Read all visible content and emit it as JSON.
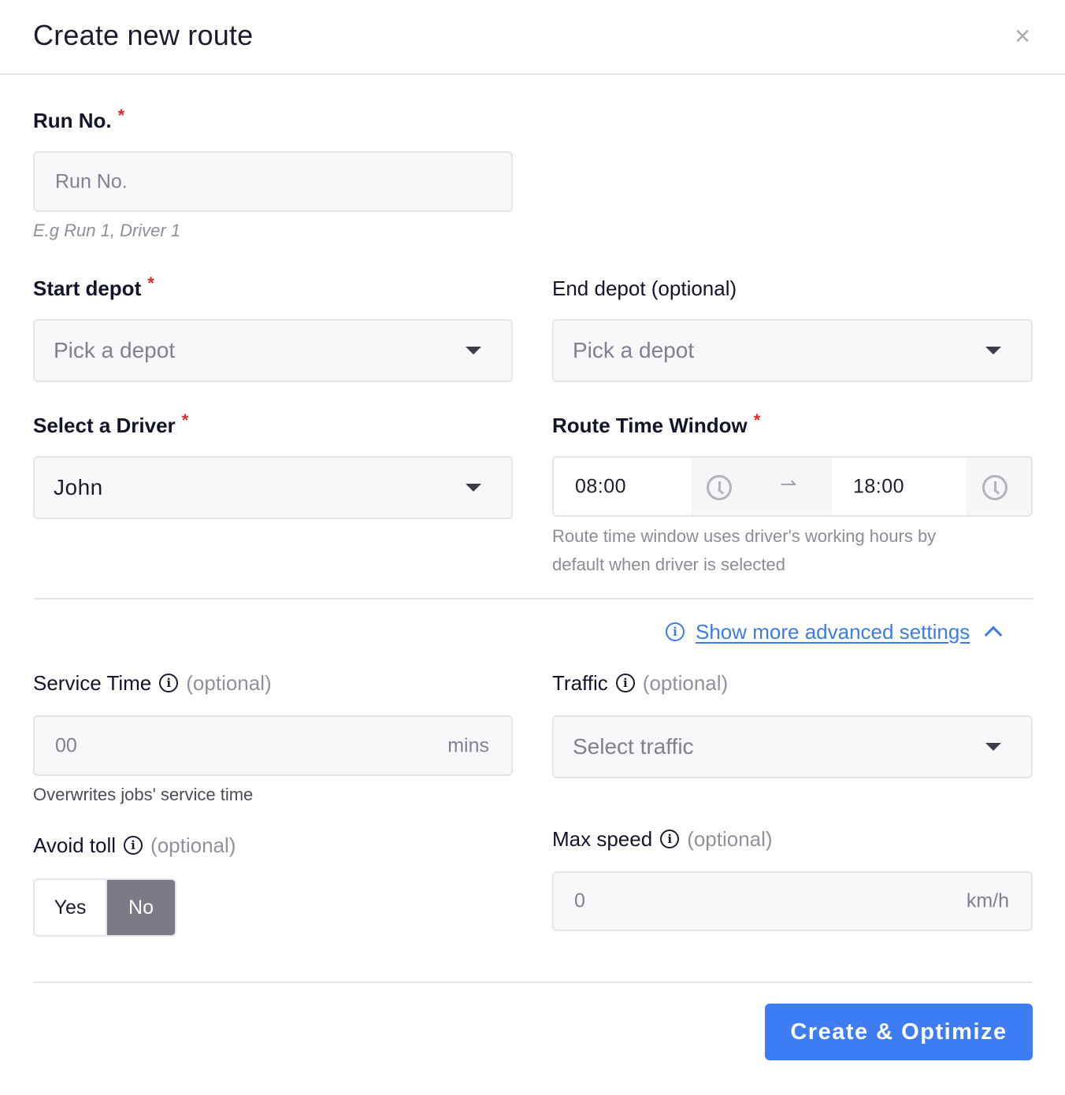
{
  "header": {
    "title": "Create new route",
    "close_glyph": "×"
  },
  "run_no": {
    "label": "Run No.",
    "required_mark": "*",
    "placeholder": "Run No.",
    "hint": "E.g Run 1, Driver 1"
  },
  "start_depot": {
    "label": "Start depot",
    "required_mark": "*",
    "placeholder": "Pick a depot"
  },
  "end_depot": {
    "label": "End depot (optional)",
    "placeholder": "Pick a depot"
  },
  "driver": {
    "label": "Select a Driver",
    "required_mark": "*",
    "value": "John"
  },
  "route_time_window": {
    "label": "Route Time Window",
    "required_mark": "*",
    "start": "08:00",
    "end": "18:00",
    "arrow": "⇀",
    "hint_line1": "Route time window uses driver's working hours by",
    "hint_line2": "default when driver is selected"
  },
  "advanced": {
    "link_text": "Show more advanced settings",
    "info_glyph": "i"
  },
  "service_time": {
    "label": "Service Time",
    "info_glyph": "i",
    "optional": "(optional)",
    "placeholder": "00",
    "unit": "mins",
    "hint": "Overwrites jobs' service time"
  },
  "traffic": {
    "label": "Traffic",
    "info_glyph": "i",
    "optional": "(optional)",
    "placeholder": "Select traffic"
  },
  "avoid_toll": {
    "label": "Avoid toll",
    "info_glyph": "i",
    "optional": "(optional)",
    "yes": "Yes",
    "no": "No",
    "selected": "No"
  },
  "max_speed": {
    "label": "Max speed",
    "info_glyph": "i",
    "optional": "(optional)",
    "placeholder": "0",
    "unit": "km/h"
  },
  "footer": {
    "submit_label": "Create & Optimize"
  },
  "colors": {
    "accent": "#3e7cf3",
    "required": "#e12a2a",
    "toggle_selected": "#7a7b86"
  }
}
